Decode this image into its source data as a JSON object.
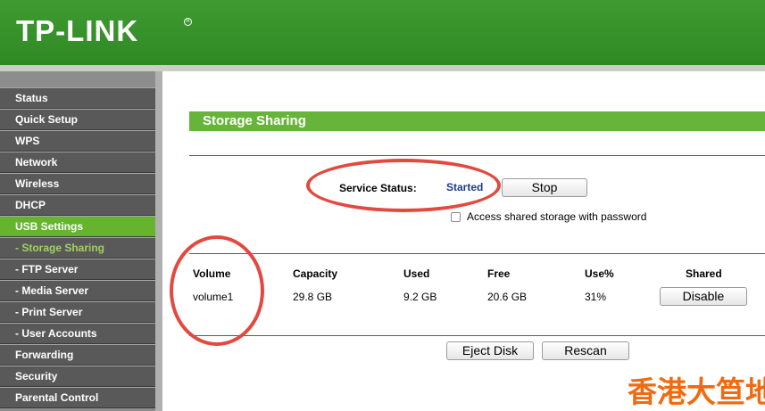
{
  "brand": {
    "logo_text": "TP-LINK",
    "reg_mark": "R"
  },
  "sidebar": {
    "items": [
      {
        "label": "Status"
      },
      {
        "label": "Quick Setup"
      },
      {
        "label": "WPS"
      },
      {
        "label": "Network"
      },
      {
        "label": "Wireless"
      },
      {
        "label": "DHCP"
      },
      {
        "label": "USB Settings"
      },
      {
        "label": "- Storage Sharing"
      },
      {
        "label": "- FTP Server"
      },
      {
        "label": "- Media Server"
      },
      {
        "label": "- Print Server"
      },
      {
        "label": "- User Accounts"
      },
      {
        "label": "Forwarding"
      },
      {
        "label": "Security"
      },
      {
        "label": "Parental Control"
      }
    ]
  },
  "main": {
    "title": "Storage Sharing",
    "service_status_label": "Service Status:",
    "service_status_value": "Started",
    "stop_button": "Stop",
    "access_checkbox_label": "Access shared storage with password",
    "table": {
      "headers": [
        "Volume",
        "Capacity",
        "Used",
        "Free",
        "Use%",
        "Shared"
      ],
      "rows": [
        {
          "volume": "volume1",
          "capacity": "29.8 GB",
          "used": "9.2 GB",
          "free": "20.6 GB",
          "use_pct": "31%",
          "shared_button": "Disable"
        }
      ]
    },
    "eject_button": "Eject Disk",
    "rescan_button": "Rescan"
  },
  "watermark": "香港大笪地",
  "colors": {
    "header_green": "#3a962d",
    "accent_green": "#67b43a",
    "annotation_red": "#e2493f"
  }
}
